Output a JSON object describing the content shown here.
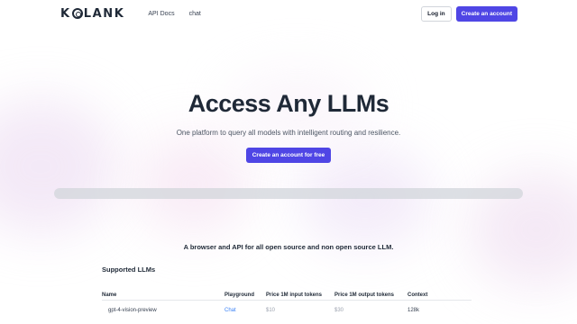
{
  "header": {
    "logo": "KOLANK",
    "nav": [
      "API Docs",
      "chat"
    ],
    "login": "Log in",
    "create": "Create an account"
  },
  "hero": {
    "title": "Access Any LLMs",
    "subtitle": "One platform to query all models with intelligent routing and resilience.",
    "cta": "Create an account for free"
  },
  "tagline": "A browser and API for all open source and non open source LLM.",
  "section_title": "Supported LLMs",
  "table": {
    "headers": [
      "Name",
      "Playground",
      "Price 1M input tokens",
      "Price 1M output tokens",
      "Context"
    ],
    "rows": [
      [
        "gpt-4-vision-preview",
        "Chat",
        "$10",
        "$30",
        "128k"
      ]
    ]
  }
}
